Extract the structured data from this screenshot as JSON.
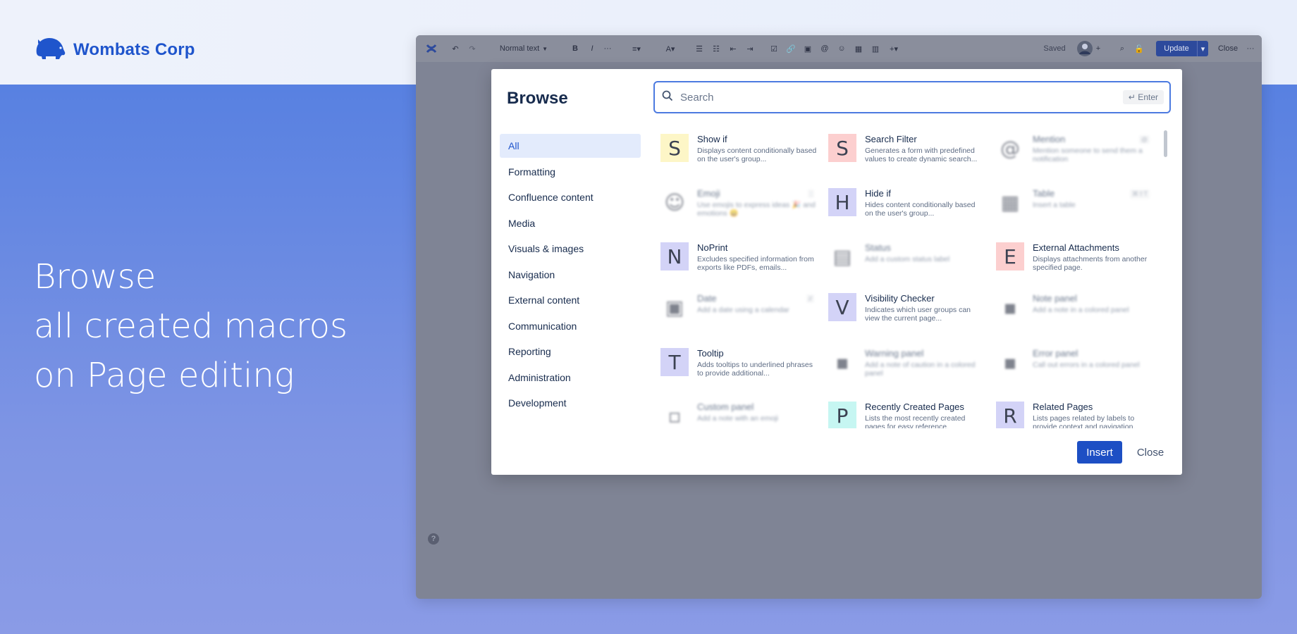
{
  "brand": {
    "name": "Wombats Corp"
  },
  "headline": {
    "line1": "Browse",
    "line2": "all created macros",
    "line3": "on Page editing"
  },
  "editor": {
    "text_style": "Normal text",
    "saved": "Saved",
    "update": "Update",
    "close": "Close",
    "help": "?"
  },
  "dialog": {
    "title": "Browse",
    "search": {
      "placeholder": "Search",
      "hint": "↵ Enter"
    },
    "categories": [
      "All",
      "Formatting",
      "Confluence content",
      "Media",
      "Visuals & images",
      "Navigation",
      "External content",
      "Communication",
      "Reporting",
      "Administration",
      "Development"
    ],
    "macros": [
      {
        "letter": "S",
        "name": "Show if",
        "desc": "Displays content conditionally based on the user's group...",
        "color": "#fdf6c7",
        "blur": false
      },
      {
        "letter": "S",
        "name": "Search Filter",
        "desc": "Generates a form with predefined values to create dynamic search...",
        "color": "#fccfcf",
        "blur": false
      },
      {
        "letter": "@",
        "name": "Mention",
        "desc": "Mention someone to send them a notification",
        "color": "#ffffff",
        "blur": true,
        "kbd": "@"
      },
      {
        "letter": "☺",
        "name": "Emoji",
        "desc": "Use emojis to express ideas 🎉 and emotions 😄",
        "color": "#ffffff",
        "blur": true,
        "kbd": ":"
      },
      {
        "letter": "H",
        "name": "Hide if",
        "desc": "Hides content conditionally based on the user's group...",
        "color": "#d3d3f7",
        "blur": false
      },
      {
        "letter": "▦",
        "name": "Table",
        "desc": "Insert a table",
        "color": "#ffffff",
        "blur": true,
        "kbd": "⌘⇧T"
      },
      {
        "letter": "N",
        "name": "NoPrint",
        "desc": "Excludes specified information from exports like PDFs, emails...",
        "color": "#d3d3f7",
        "blur": false
      },
      {
        "letter": "▤",
        "name": "Status",
        "desc": "Add a custom status label",
        "color": "#ffffff",
        "blur": true
      },
      {
        "letter": "E",
        "name": "External Attachments",
        "desc": "Displays attachments from another specified page.",
        "color": "#fccfcf",
        "blur": false
      },
      {
        "letter": "▣",
        "name": "Date",
        "desc": "Add a date using a calendar",
        "color": "#ffffff",
        "blur": true,
        "kbd": "//"
      },
      {
        "letter": "V",
        "name": "Visibility Checker",
        "desc": "Indicates which user groups can view the current page...",
        "color": "#d3d3f7",
        "blur": false
      },
      {
        "letter": "▪",
        "name": "Note panel",
        "desc": "Add a note in a colored panel",
        "color": "#ffffff",
        "blur": true
      },
      {
        "letter": "T",
        "name": "Tooltip",
        "desc": "Adds tooltips to underlined phrases to provide additional...",
        "color": "#d3d3f7",
        "blur": false
      },
      {
        "letter": "▪",
        "name": "Warning panel",
        "desc": "Add a note of caution in a colored panel",
        "color": "#ffffff",
        "blur": true
      },
      {
        "letter": "▪",
        "name": "Error panel",
        "desc": "Call out errors in a colored panel",
        "color": "#ffffff",
        "blur": true
      },
      {
        "letter": "▫",
        "name": "Custom panel",
        "desc": "Add a note with an emoji",
        "color": "#ffffff",
        "blur": true
      },
      {
        "letter": "P",
        "name": "Recently Created Pages",
        "desc": "Lists the most recently created pages for easy reference.",
        "color": "#c6f6f2",
        "blur": false
      },
      {
        "letter": "R",
        "name": "Related Pages",
        "desc": "Lists pages related by labels to provide context and navigation.",
        "color": "#d3d3f7",
        "blur": false
      }
    ],
    "insert": "Insert",
    "close": "Close"
  }
}
